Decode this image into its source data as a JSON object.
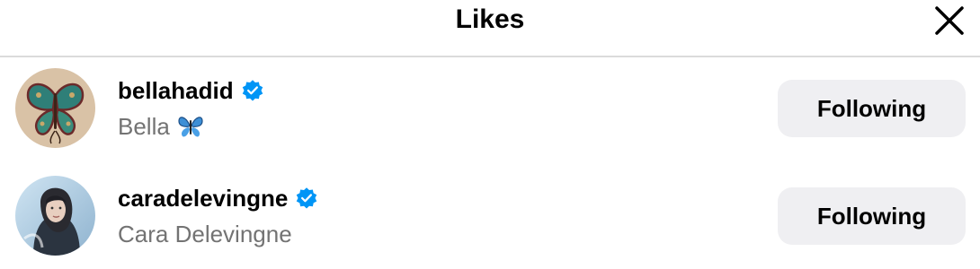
{
  "header": {
    "title": "Likes",
    "close_icon": "close-icon"
  },
  "likes": [
    {
      "username": "bellahadid",
      "full_name": "Bella",
      "name_emoji": "butterfly-emoji",
      "verified": true,
      "button_label": "Following"
    },
    {
      "username": "caradelevingne",
      "full_name": "Cara Delevingne",
      "verified": true,
      "button_label": "Following"
    }
  ],
  "colors": {
    "verified_badge": "#0095f6",
    "secondary_text": "#737373",
    "button_bg": "#efeff2",
    "divider": "#dbdbdb"
  }
}
